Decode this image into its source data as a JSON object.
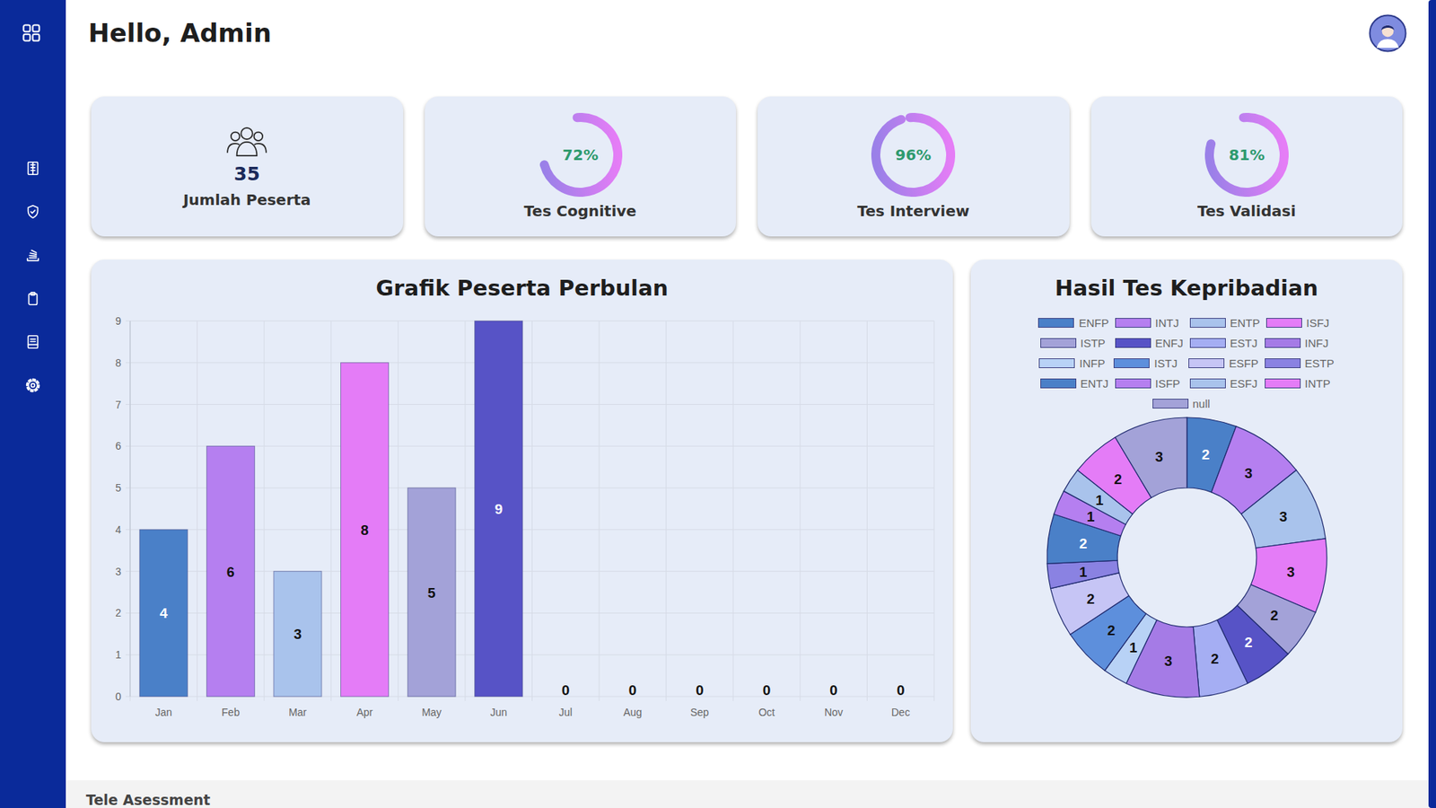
{
  "header": {
    "greeting": "Hello, Admin"
  },
  "stats": [
    {
      "kind": "count",
      "value": "35",
      "label": "Jumlah Peserta"
    },
    {
      "kind": "ring",
      "value": "72%",
      "label": "Tes Cognitive",
      "level": 0.72
    },
    {
      "kind": "ring",
      "value": "96%",
      "label": "Tes Interview",
      "level": 0.96
    },
    {
      "kind": "ring",
      "value": "81%",
      "label": "Tes Validasi",
      "level": 0.81
    }
  ],
  "bar_chart": {
    "title": "Grafik Peserta Perbulan",
    "y_ticks": [
      "0",
      "1",
      "2",
      "3",
      "4",
      "5",
      "6",
      "7",
      "8",
      "9"
    ],
    "bars": [
      {
        "month": "Jan",
        "value": 4,
        "label": "4",
        "color": "#4a80c8"
      },
      {
        "month": "Feb",
        "value": 6,
        "label": "6",
        "color": "#b57ff0"
      },
      {
        "month": "Mar",
        "value": 3,
        "label": "3",
        "color": "#a9c3ec"
      },
      {
        "month": "Apr",
        "value": 8,
        "label": "8",
        "color": "#e47cf7"
      },
      {
        "month": "May",
        "value": 5,
        "label": "5",
        "color": "#a3a2d8"
      },
      {
        "month": "Jun",
        "value": 9,
        "label": "9",
        "color": "#5753c6"
      },
      {
        "month": "Jul",
        "value": 0,
        "label": "0",
        "color": "#a5aef3"
      },
      {
        "month": "Aug",
        "value": 0,
        "label": "0",
        "color": "#a57be6"
      },
      {
        "month": "Sep",
        "value": 0,
        "label": "0",
        "color": "#b8d2f6"
      },
      {
        "month": "Oct",
        "value": 0,
        "label": "0",
        "color": "#5d8fdc"
      },
      {
        "month": "Nov",
        "value": 0,
        "label": "0",
        "color": "#c6c5f5"
      },
      {
        "month": "Dec",
        "value": 0,
        "label": "0",
        "color": "#8a82e2"
      }
    ]
  },
  "donut_chart": {
    "title": "Hasil Tes Kepribadian",
    "segments": [
      {
        "label": "ENFP",
        "value": 2,
        "reading": "2",
        "color": "#4a80c8"
      },
      {
        "label": "INTJ",
        "value": 3,
        "reading": "3",
        "color": "#b57ff0"
      },
      {
        "label": "ENTP",
        "value": 3,
        "reading": "3",
        "color": "#a9c3ec"
      },
      {
        "label": "ISFJ",
        "value": 3,
        "reading": "3",
        "color": "#e47cf7"
      },
      {
        "label": "ISTP",
        "value": 2,
        "reading": "2",
        "color": "#a3a2d8"
      },
      {
        "label": "ENFJ",
        "value": 2,
        "reading": "2",
        "color": "#5753c6"
      },
      {
        "label": "ESTJ",
        "value": 2,
        "reading": "2",
        "color": "#a5aef3"
      },
      {
        "label": "INFJ",
        "value": 3,
        "reading": "3",
        "color": "#a57be6"
      },
      {
        "label": "INFP",
        "value": 1,
        "reading": "1",
        "color": "#b8d2f6"
      },
      {
        "label": "ISTJ",
        "value": 2,
        "reading": "2",
        "color": "#5d8fdc"
      },
      {
        "label": "ESFP",
        "value": 2,
        "reading": "2",
        "color": "#c6c5f5"
      },
      {
        "label": "ESTP",
        "value": 1,
        "reading": "1",
        "color": "#8a82e2"
      },
      {
        "label": "ENTJ",
        "value": 2,
        "reading": "2",
        "color": "#4a80c8"
      },
      {
        "label": "ISFP",
        "value": 1,
        "reading": "1",
        "color": "#b57ff0"
      },
      {
        "label": "ESFJ",
        "value": 1,
        "reading": "1",
        "color": "#a9c3ec"
      },
      {
        "label": "INTP",
        "value": 2,
        "reading": "2",
        "color": "#e47cf7"
      },
      {
        "label": "null",
        "value": 3,
        "reading": "3",
        "color": "#a3a2d8"
      }
    ]
  },
  "footer": {
    "title": "Tele Asessment"
  }
}
